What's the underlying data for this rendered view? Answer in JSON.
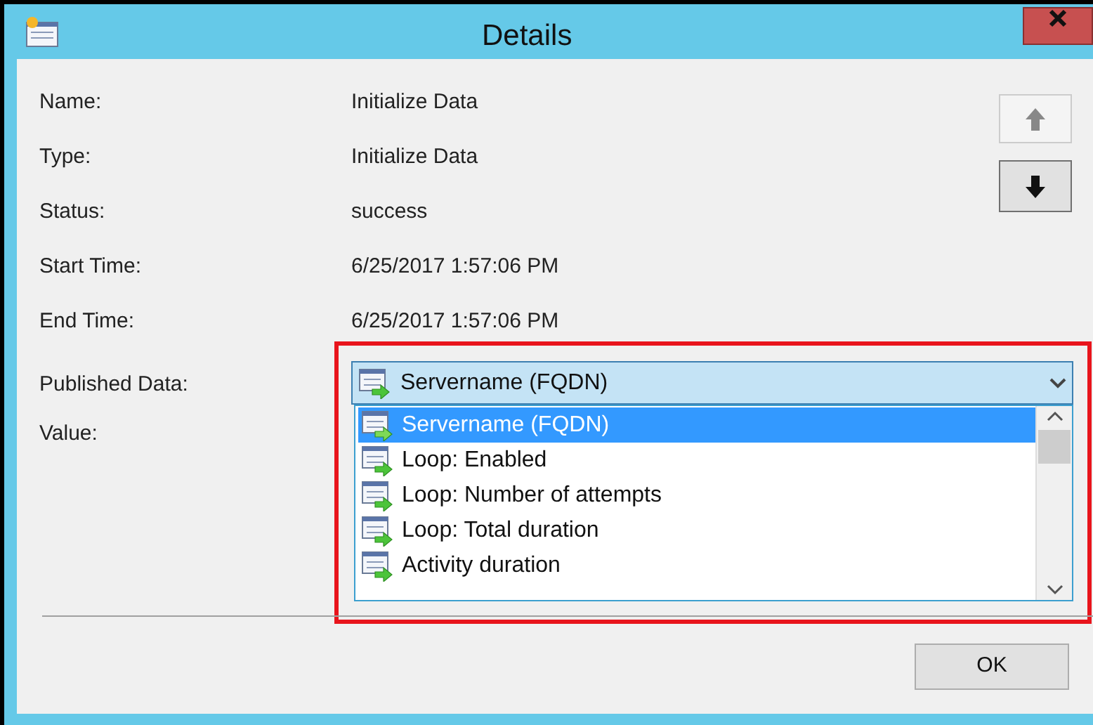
{
  "window": {
    "title": "Details"
  },
  "fields": [
    {
      "label": "Name:",
      "value": "Initialize Data"
    },
    {
      "label": "Type:",
      "value": "Initialize Data"
    },
    {
      "label": "Status:",
      "value": "success"
    },
    {
      "label": "Start Time:",
      "value": "6/25/2017 1:57:06 PM"
    },
    {
      "label": "End Time:",
      "value": "6/25/2017 1:57:06 PM"
    }
  ],
  "published_data": {
    "label": "Published Data:",
    "value": "Servername (FQDN)",
    "expanded": true,
    "options": [
      {
        "label": "Servername (FQDN)",
        "selected": true
      },
      {
        "label": "Loop: Enabled",
        "selected": false
      },
      {
        "label": "Loop: Number of attempts",
        "selected": false
      },
      {
        "label": "Loop: Total duration",
        "selected": false
      },
      {
        "label": "Activity duration",
        "selected": false
      }
    ]
  },
  "value_label": "Value:",
  "nav": {
    "up_disabled": true,
    "down_disabled": false
  },
  "buttons": [
    "OK"
  ]
}
